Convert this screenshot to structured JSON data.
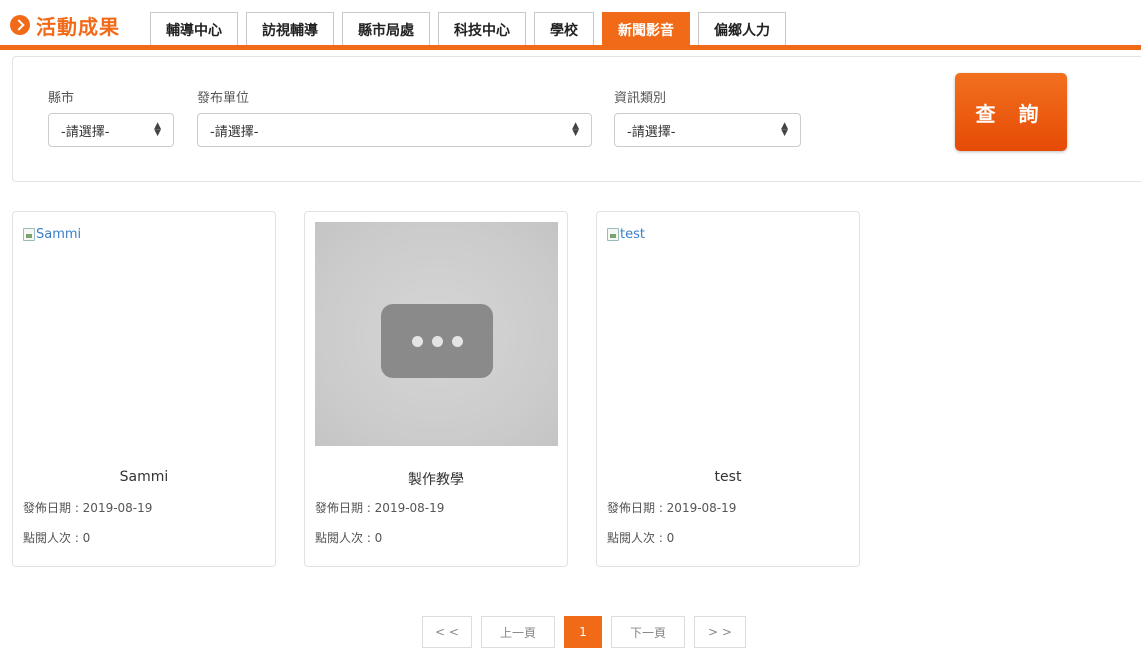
{
  "header": {
    "title": "活動成果",
    "tabs": [
      "輔導中心",
      "訪視輔導",
      "縣市局處",
      "科技中心",
      "學校",
      "新聞影音",
      "偏鄉人力"
    ],
    "active_tab": "新聞影音",
    "accent_color": "#f06a18"
  },
  "filters": {
    "county": {
      "label": "縣市",
      "value": "-請選擇-"
    },
    "unit": {
      "label": "發布單位",
      "value": "-請選擇-"
    },
    "category": {
      "label": "資訊類別",
      "value": "-請選擇-"
    },
    "query_label": "查 詢"
  },
  "cards": [
    {
      "image_alt": "Sammi",
      "title": "Sammi",
      "date": "發佈日期 : 2019-08-19",
      "views": "點閱人次 : 0"
    },
    {
      "image_alt": "",
      "title": "製作教學",
      "date": "發佈日期 : 2019-08-19",
      "views": "點閱人次 : 0"
    },
    {
      "image_alt": "test",
      "title": "test",
      "date": "發佈日期 : 2019-08-19",
      "views": "點閱人次 : 0"
    }
  ],
  "pagination": {
    "first": "< <",
    "prev": "上一頁",
    "current": "1",
    "next": "下一頁",
    "last": "> >"
  }
}
